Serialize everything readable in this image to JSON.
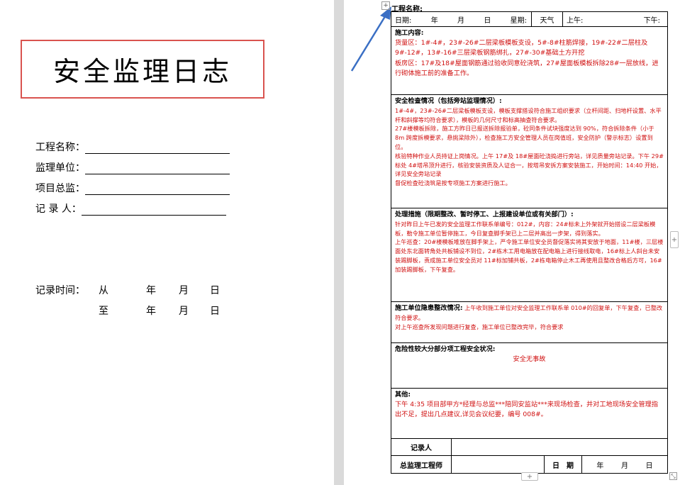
{
  "cover": {
    "title": "安全监理日志",
    "fields": [
      {
        "label": "工程名称："
      },
      {
        "label": "监理单位："
      },
      {
        "label": "项目总监："
      },
      {
        "label": "记 录 人："
      }
    ],
    "record_time_label": "记录时间：",
    "from": "从",
    "to": "至",
    "year": "年",
    "month": "月",
    "day": "日"
  },
  "log": {
    "project_label": "工程名称:",
    "header": {
      "date": "日期:",
      "year": "年",
      "month": "月",
      "day": "日",
      "weekday": "星期:",
      "weather": "天气",
      "am": "上午:",
      "pm": "下午:"
    },
    "construction": {
      "title": "施工内容:",
      "lines": [
        "货量区：1#-4#，23#-26#二层梁板模板支设，5#-8#柱筋焊接，19#-22#二层柱及9#-12#，13#-16#三层梁板钢筋绑扎，27#-30#基础土方开挖",
        "板房区：17#及18#屋面钢筋通过验收同意砼浇筑，27#屋面板模板拆除28#一层放线，进行砌体施工前的准备工作。"
      ]
    },
    "safety": {
      "title": "安全检查情况（包括旁站监理情况）:",
      "lines": [
        "1#-4#，23#-26#二层梁板模板支设，模板支撑搭设符合施工组织要求（立杆间距、扫地杆设置、水平杆和斜撑等均符合要求），模板的几何尺寸和标高抽查符合要求。",
        "27#楼模板拆除，施工方昨日已报送拆除报验单，砼同条件试块强度达到 90%，符合拆除条件（小于 8m 跨度拆模要求，悬挑梁除外），检查施工方安全管理人员在岗值班，安全防护（警示标志）设置到位。",
        "核验特种作业人员持证上岗情况。上午 17#及 18#屋面砼浇捣进行旁站，详见质量旁站记录。下午 29#标处 4#塔吊顶升进行，核验安装资质及人证合一，按塔吊安拆方案安装施工，开始时间：14:40 开始，详见安全旁站记录",
        "督促检查砼浇筑是按专项施工方案进行施工。"
      ]
    },
    "measures": {
      "title": "处理措施（限期整改、暂时停工、上报建设单位或有关部门）:",
      "lines": [
        "针对昨日上午已发的安全监理工作联系单编号：012#，内容：24#标未上外架就开始搭设二层梁板模板，勒令施工单位暂停施工，今日复查脚手架已上二层并高出一步架，得到落实。",
        "上午巡查：20#楼模板堆放在脚手架上，严令施工单位安全员督促落实将其安放于地面，11#楼，三层楼面处东北面转角处共板铺设不到位，2#栋木工用电箱放在配电箱上进行接线取电，16#标上人斜台未安装踢脚板，责成施工单位安全员对 11#标加铺共板，2#栋电箱停止木工再使用且整改合格后方可，16#加装踢脚板，下午复查。"
      ]
    },
    "rectification": {
      "title": "施工单位隐患整改情况:",
      "lines": [
        "上午收到施工单位对安全监理工作联系单 010#的回复单，下午复查，已整改符合要求。",
        "对上午巡查所发现问题进行复查，施工单位已整改完毕，符合要求"
      ]
    },
    "dangerous": {
      "title": "危险性较大分部分项工程安全状况:",
      "text": "安全无事故"
    },
    "other": {
      "title": "其他:",
      "lines": [
        "下午 4:35 项目部甲方*经理与总监***陪同安监站***来现场检查，并对工地现场安全管理指出不足，提出几点建议,详见会议纪要，编号 008#。"
      ]
    },
    "recorder_label": "记录人",
    "chief_label": "总监理工程师",
    "date_label": "日　期",
    "sign_year": "年",
    "sign_month": "月",
    "sign_day": "日"
  },
  "colors": {
    "title_border": "#d9534f",
    "arrow": "#3a6fc4",
    "red_text": "#d01010"
  }
}
